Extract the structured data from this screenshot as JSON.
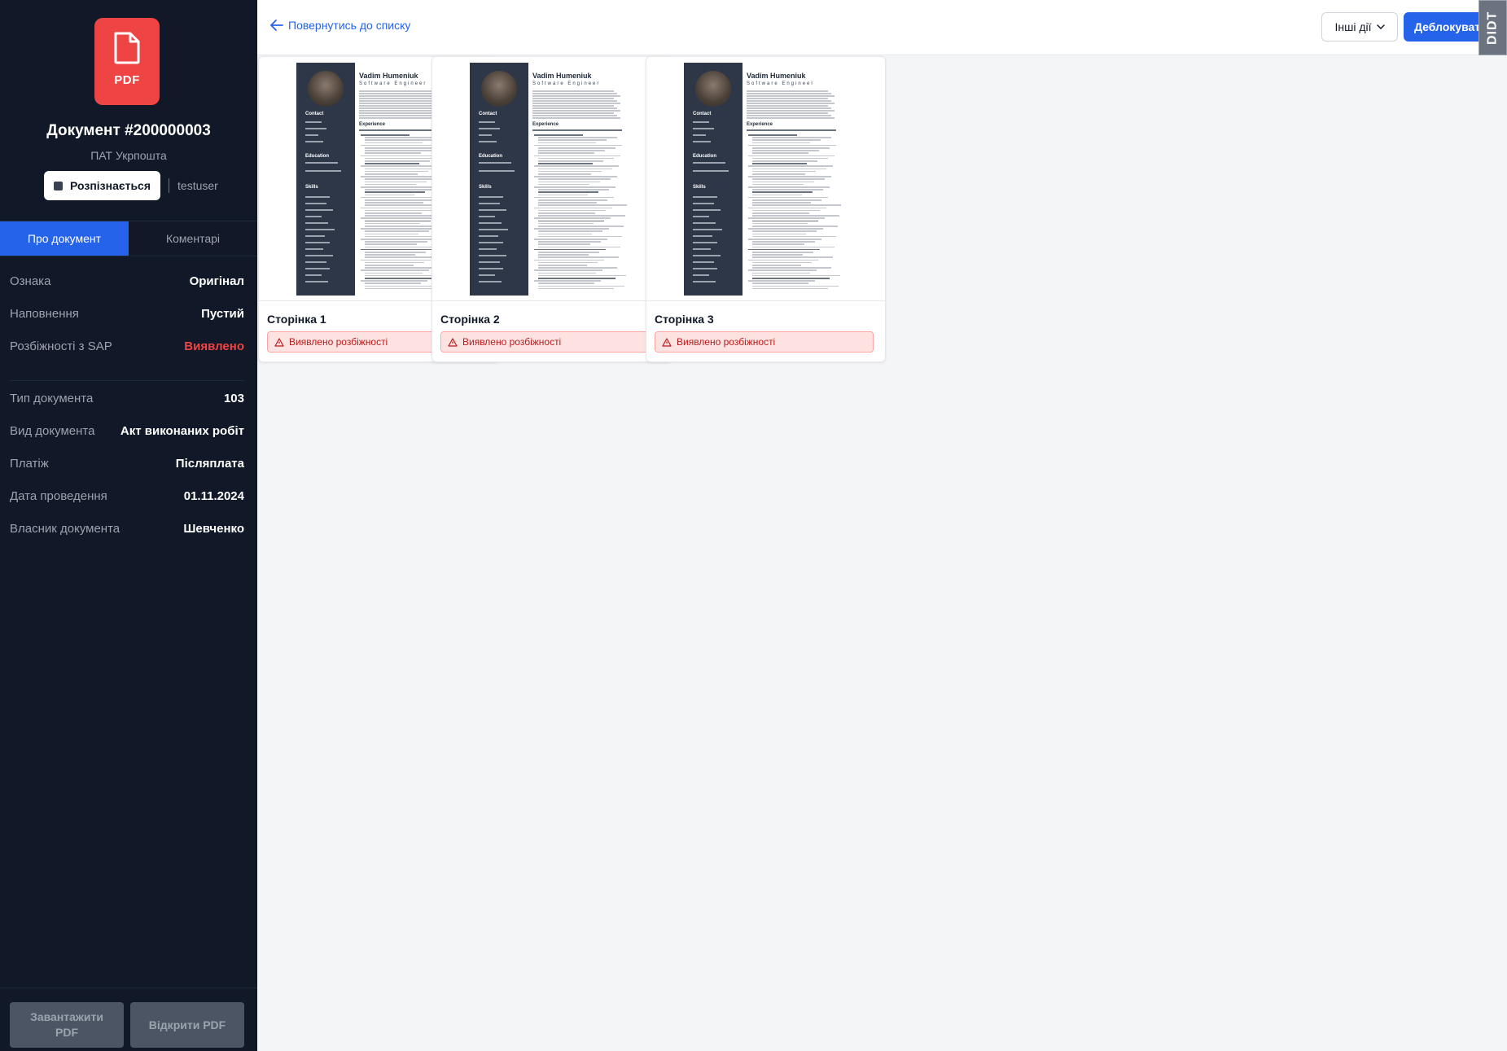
{
  "sidebar": {
    "badge_text": "PDF",
    "title": "Документ #200000003",
    "organization": "ПАТ Укрпошта",
    "status_label": "Розпізнається",
    "user": "testuser",
    "tabs": [
      {
        "label": "Про документ",
        "active": true
      },
      {
        "label": "Коментарі",
        "active": false
      }
    ],
    "info_group1": [
      {
        "label": "Ознака",
        "value": "Оригінал"
      },
      {
        "label": "Наповнення",
        "value": "Пустий"
      },
      {
        "label": "Розбіжності з SAP",
        "value": "Виявлено"
      }
    ],
    "info_group2": [
      {
        "label": "Тип документа",
        "value": "103"
      },
      {
        "label": "Вид документа",
        "value": "Акт виконаних робіт"
      },
      {
        "label": "Платіж",
        "value": "Післяплата"
      },
      {
        "label": "Дата проведення",
        "value": "01.11.2024"
      },
      {
        "label": "Власник документа",
        "value": "Шевченко"
      }
    ],
    "download_button": "Завантажити PDF",
    "open_button": "Відкрити PDF"
  },
  "topbar": {
    "back_link": "Повернутись до списку",
    "other_actions": "Інші дії",
    "unlock_button": "Деблокувати",
    "corner_logo": "DIDT"
  },
  "pages": [
    {
      "label": "Сторінка 1",
      "warning": "Виявлено розбіжності"
    },
    {
      "label": "Сторінка 2",
      "warning": "Виявлено розбіжності"
    },
    {
      "label": "Сторінка 3",
      "warning": "Виявлено розбіжності"
    }
  ],
  "resume_thumb": {
    "name": "Vadim Humeniuk",
    "role": "Software Engineer",
    "sections": [
      "Contact",
      "Education",
      "Skills",
      "Experience"
    ]
  },
  "colors": {
    "sidebar_bg": "#111827",
    "accent": "#2563eb",
    "danger": "#ef4444",
    "pdf_badge": "#ef4444"
  }
}
